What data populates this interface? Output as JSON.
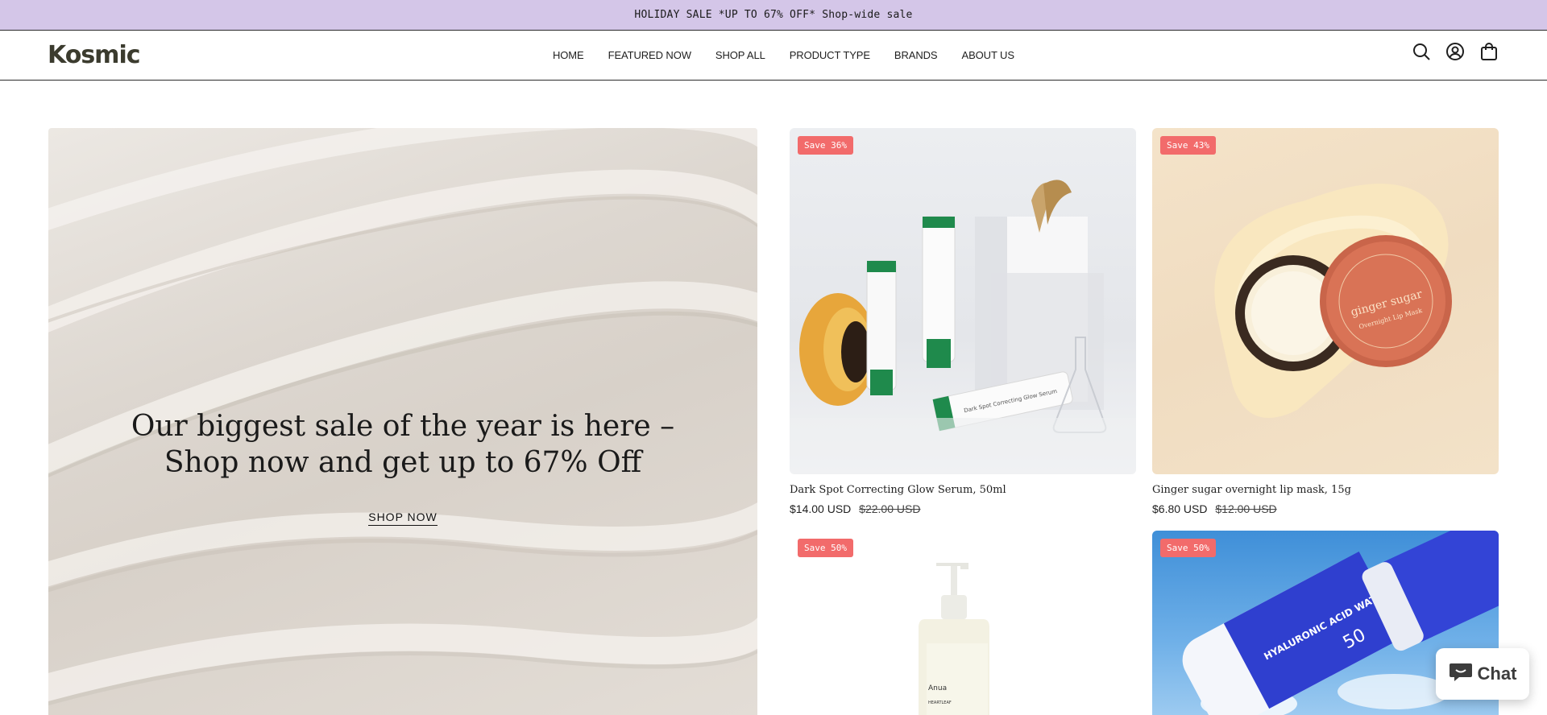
{
  "announcement": {
    "text": "HOLIDAY SALE *UP TO 67% OFF* Shop-wide sale"
  },
  "header": {
    "logo": "Kosmic",
    "nav": [
      "HOME",
      "FEATURED NOW",
      "SHOP ALL",
      "PRODUCT TYPE",
      "BRANDS",
      "ABOUT US"
    ],
    "icons": [
      "search-icon",
      "account-icon",
      "cart-icon"
    ]
  },
  "hero": {
    "title": "Our biggest sale of the year is here – Shop now and get up to 67% Off",
    "cta": "SHOP NOW"
  },
  "products": [
    {
      "badge": "Save 36%",
      "name": "Dark Spot Correcting Glow Serum, 50ml",
      "price": "$14.00 USD",
      "compare_price": "$22.00 USD"
    },
    {
      "badge": "Save 43%",
      "name": "Ginger sugar overnight lip mask, 15g",
      "price": "$6.80 USD",
      "compare_price": "$12.00 USD"
    },
    {
      "badge": "Save 50%"
    },
    {
      "badge": "Save 50%"
    }
  ],
  "product_labels": {
    "serum_tube": "Dark Spot Correcting Glow Serum",
    "lip_mask_brand": "ginger sugar",
    "lip_mask_sub": "Overnight Lip Mask",
    "cleanser_brand": "Anua",
    "cleanser_name": "HEARTLEAF",
    "sunscreen_text": "HYALURONIC ACID WATERY SUN GEL",
    "sunscreen_spf": "50"
  },
  "chat": {
    "label": "Chat"
  },
  "colors": {
    "announcement_bg": "#d4c6e8",
    "badge_bg": "#f26b6b"
  }
}
